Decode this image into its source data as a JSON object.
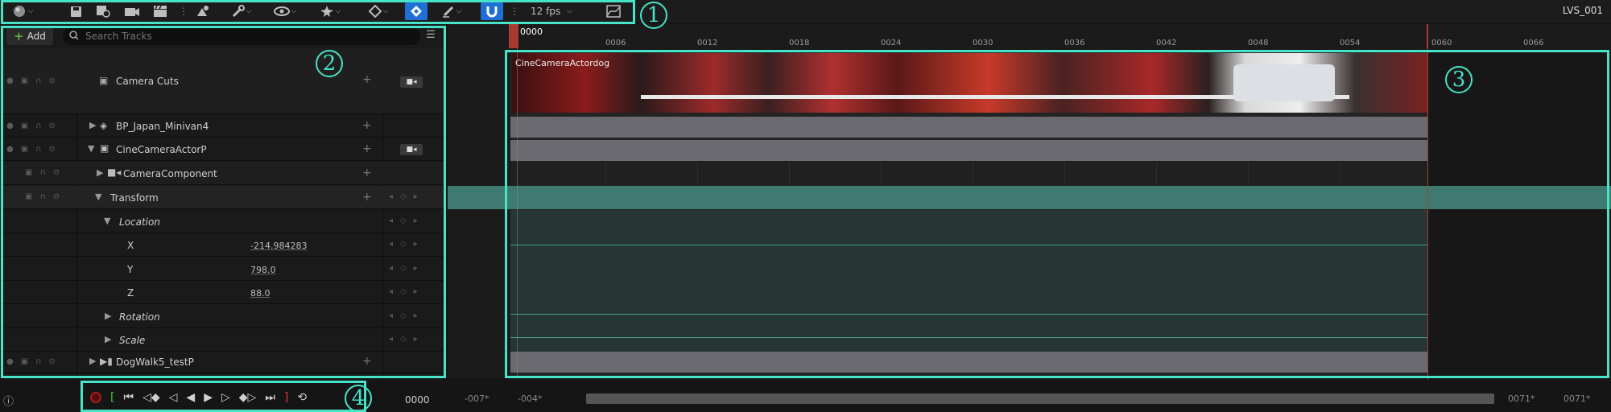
{
  "toolbar": {
    "fps_label": "12 fps",
    "caret": "⌵",
    "sequence_name": "LVS_001",
    "icons": [
      "world-icon",
      "save-icon",
      "save-as-icon",
      "render-camera-icon",
      "clapper-icon",
      "actor-icon",
      "wrench-icon",
      "eye-icon",
      "spark-icon",
      "key-diamond-icon",
      "auto-key-icon",
      "pen-icon",
      "magnet-icon",
      "curve-editor-icon"
    ]
  },
  "callouts": [
    "1",
    "2",
    "3",
    "4"
  ],
  "outliner": {
    "add_label": "Add",
    "search_placeholder": "Search Tracks",
    "tracks": [
      {
        "name": "Camera Cuts"
      },
      {
        "name": "BP_Japan_Minivan4"
      },
      {
        "name": "CineCameraActorP"
      },
      {
        "name": "CameraComponent"
      },
      {
        "name": "Transform"
      },
      {
        "name": "Location"
      },
      {
        "name": "X",
        "value": "-214.984283"
      },
      {
        "name": "Y",
        "value": "798.0"
      },
      {
        "name": "Z",
        "value": "88.0"
      },
      {
        "name": "Rotation"
      },
      {
        "name": "Scale"
      },
      {
        "name": "DogWalk5_testP"
      }
    ]
  },
  "timeline": {
    "current_frame": "0000",
    "ticks": [
      "0006",
      "0012",
      "0018",
      "0024",
      "0030",
      "0036",
      "0042",
      "0048",
      "0054",
      "0060",
      "0066"
    ],
    "clip_label": "CineCameraActordog",
    "range_start_a": "-007*",
    "range_start_b": "-004*",
    "range_end_a": "0071*",
    "range_end_b": "0071*"
  },
  "transport": {
    "frame_display": "0000"
  },
  "colors": {
    "accent": "#46e3c6",
    "playhead": "#c0392b",
    "selected_row": "#3f7a70",
    "track_bar": "#6a6a70"
  }
}
